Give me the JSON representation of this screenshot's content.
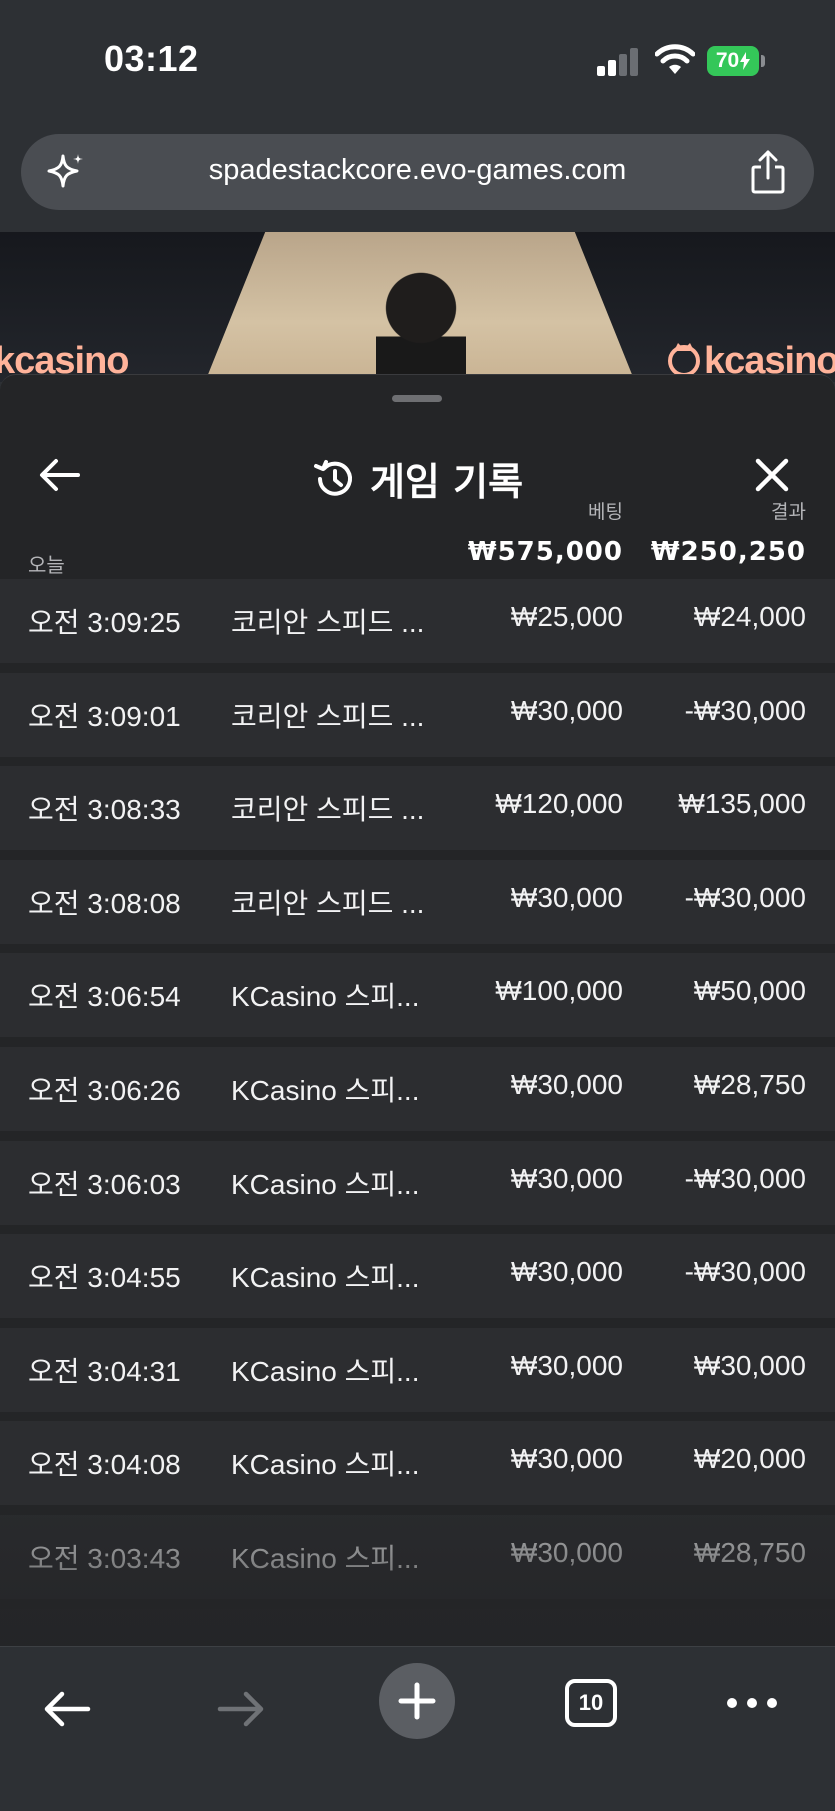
{
  "status_bar": {
    "time": "03:12",
    "battery": "70"
  },
  "browser": {
    "url": "spadestackcore.evo-games.com",
    "tab_count": "10"
  },
  "video": {
    "logo_left": "kcasino",
    "logo_right": "kcasino"
  },
  "sheet": {
    "title": "게임 기록",
    "columns": {
      "bet": "베팅",
      "result": "결과"
    },
    "today_label": "오늘",
    "total_bet": "₩575,000",
    "total_result": "₩250,250",
    "rows": [
      {
        "time": "오전 3:09:25",
        "game": "코리안 스피드 ...",
        "bet": "₩25,000",
        "result": "₩24,000"
      },
      {
        "time": "오전 3:09:01",
        "game": "코리안 스피드 ...",
        "bet": "₩30,000",
        "result": "-₩30,000"
      },
      {
        "time": "오전 3:08:33",
        "game": "코리안 스피드 ...",
        "bet": "₩120,000",
        "result": "₩135,000"
      },
      {
        "time": "오전 3:08:08",
        "game": "코리안 스피드 ...",
        "bet": "₩30,000",
        "result": "-₩30,000"
      },
      {
        "time": "오전 3:06:54",
        "game": "KCasino 스피...",
        "bet": "₩100,000",
        "result": "₩50,000"
      },
      {
        "time": "오전 3:06:26",
        "game": "KCasino 스피...",
        "bet": "₩30,000",
        "result": "₩28,750"
      },
      {
        "time": "오전 3:06:03",
        "game": "KCasino 스피...",
        "bet": "₩30,000",
        "result": "-₩30,000"
      },
      {
        "time": "오전 3:04:55",
        "game": "KCasino 스피...",
        "bet": "₩30,000",
        "result": "-₩30,000"
      },
      {
        "time": "오전 3:04:31",
        "game": "KCasino 스피...",
        "bet": "₩30,000",
        "result": "₩30,000"
      },
      {
        "time": "오전 3:04:08",
        "game": "KCasino 스피...",
        "bet": "₩30,000",
        "result": "₩20,000"
      },
      {
        "time": "오전 3:03:43",
        "game": "KCasino 스피...",
        "bet": "₩30,000",
        "result": "₩28,750"
      }
    ]
  },
  "colors": {
    "background": "#2d3034",
    "sheet": "#242527",
    "row": "#2c2d30",
    "battery": "#34c759",
    "logo": "#ffb39a"
  },
  "icons": {
    "url_left": "sparkle-icon",
    "url_right": "share-icon",
    "sheet_back": "arrow-left-icon",
    "sheet_title": "history-icon",
    "sheet_close": "close-icon",
    "toolbar": [
      "arrow-left-icon",
      "arrow-right-icon",
      "plus-icon",
      "tabs-icon",
      "more-icon"
    ]
  }
}
